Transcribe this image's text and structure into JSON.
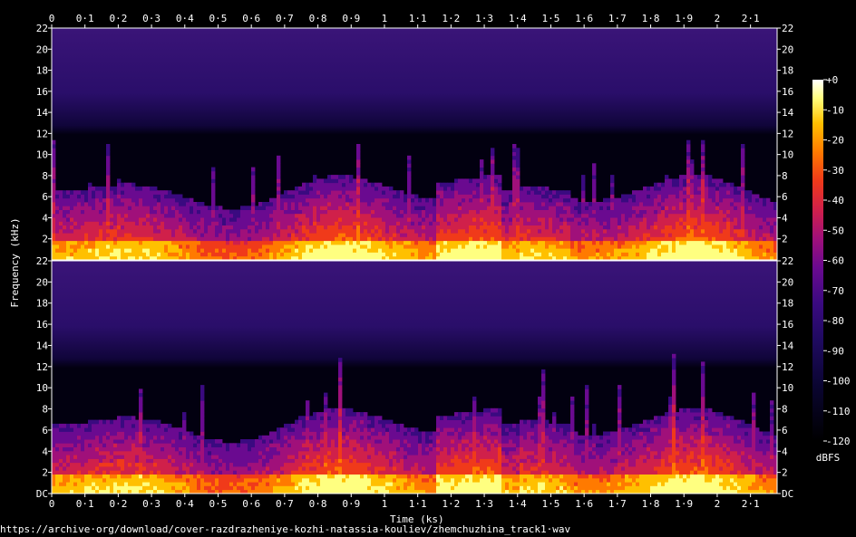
{
  "chart_data": {
    "type": "heatmap",
    "title": "",
    "xlabel": "Time (ks)",
    "ylabel": "Frequency (kHz)",
    "x_ticks": [
      "0",
      "0·1",
      "0·2",
      "0·3",
      "0·4",
      "0·5",
      "0·6",
      "0·7",
      "0·8",
      "0·9",
      "1",
      "1·1",
      "1·2",
      "1·3",
      "1·4",
      "1·5",
      "1·6",
      "1·7",
      "1·8",
      "1·9",
      "2",
      "2·1"
    ],
    "xlim": [
      0,
      2.18
    ],
    "y_ticks": [
      "22",
      "20",
      "18",
      "16",
      "14",
      "12",
      "10",
      "8",
      "6",
      "4",
      "2"
    ],
    "y_ticks_bottom_channel": [
      "22",
      "20",
      "18",
      "16",
      "14",
      "12",
      "10",
      "8",
      "6",
      "4",
      "2",
      "DC"
    ],
    "ylim": [
      0,
      22
    ],
    "channels": 2,
    "colorbar": {
      "label": "dBFS",
      "ticks": [
        "+0",
        "-10",
        "-20",
        "-30",
        "-40",
        "-50",
        "-60",
        "-70",
        "-80",
        "-90",
        "-100",
        "-110",
        "-120"
      ],
      "range": [
        -120,
        0
      ]
    },
    "palette": [
      "#000000",
      "#0a0530",
      "#1f0a60",
      "#3a0a80",
      "#6a0a90",
      "#a0107a",
      "#d0204a",
      "#f03a1a",
      "#ff7a00",
      "#ffc000",
      "#ffff80",
      "#ffffff"
    ],
    "grid": false,
    "legend": "none"
  },
  "footer": {
    "url": "https://archive·org/download/cover-razdrazheniye-kozhi-natassia-kouliev/zhemchuzhina_track1·wav"
  }
}
